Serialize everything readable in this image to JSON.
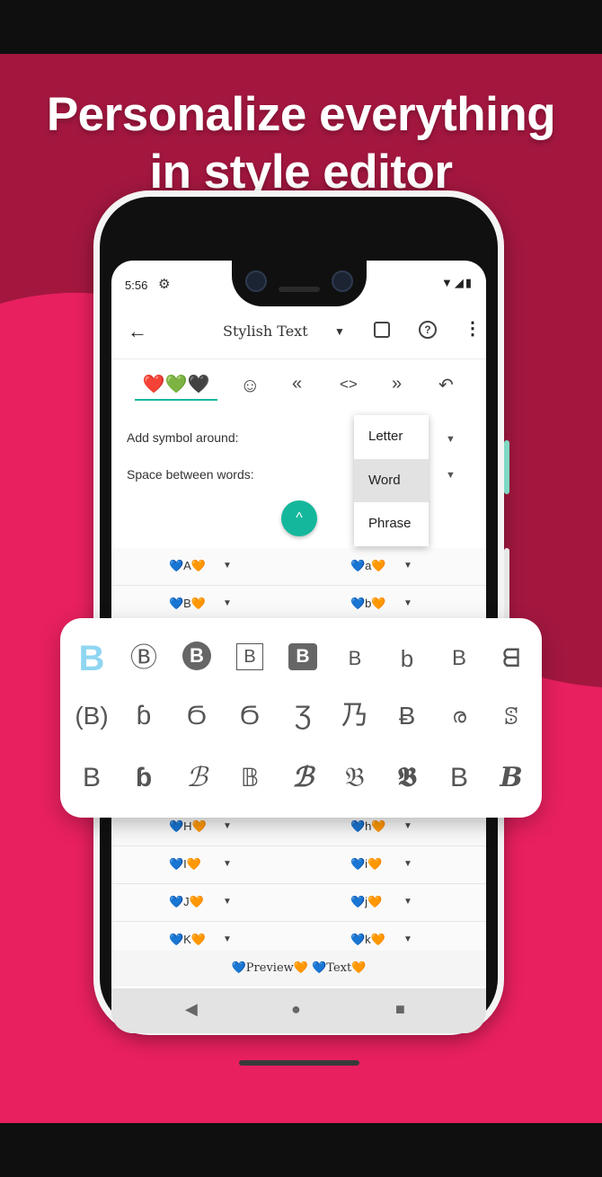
{
  "headline": {
    "line1": "Personalize everything",
    "line2": "in style editor"
  },
  "status": {
    "time": "5:56",
    "icons": "▼◢▮"
  },
  "appbar": {
    "title": "Stylish Text",
    "help": "?"
  },
  "editor": {
    "symbol_value": "❤️💚🖤",
    "tools": {
      "emoji": "☺",
      "prev": "«",
      "code": "<>",
      "next": "»",
      "undo": "↶"
    },
    "add_symbol_label": "Add symbol around:",
    "space_label": "Space between words:",
    "fab": "^"
  },
  "dropdown_menu": {
    "options": [
      "Letter",
      "Word",
      "Phrase"
    ],
    "selected": "Word"
  },
  "mapping_rows": [
    {
      "left": "💙A🧡",
      "right": "💙a🧡"
    },
    {
      "left": "💙B🧡",
      "right": "💙b🧡"
    },
    {
      "left": "💙H🧡",
      "right": "💙h🧡"
    },
    {
      "left": "💙I🧡",
      "right": "💙i🧡"
    },
    {
      "left": "💙J🧡",
      "right": "💙j🧡"
    },
    {
      "left": "💙K🧡",
      "right": "💙k🧡"
    }
  ],
  "preview": "💙Preview🧡 💙Text🧡",
  "nav": {
    "back": "◀",
    "home": "●",
    "recent": "■"
  },
  "style_card": {
    "accent": "#8fd6f2",
    "row1": [
      "B",
      "Ⓑ",
      "B",
      "B",
      "B",
      "B",
      "b",
      "B",
      "ᗺ"
    ],
    "row2": [
      "(B)",
      "ɓ",
      "Ϭ",
      "Ϭ",
      "Ʒ",
      "乃",
      "Ƀ",
      "ര",
      "ꕷ"
    ],
    "row3": [
      "B",
      "ɓ",
      "ℬ",
      "𝔹",
      "ℬ",
      "𝔅",
      "𝕭",
      "B",
      "B"
    ]
  },
  "colors": {
    "background": "#a3173f",
    "wave": "#e8205f",
    "teal": "#15b79c"
  }
}
